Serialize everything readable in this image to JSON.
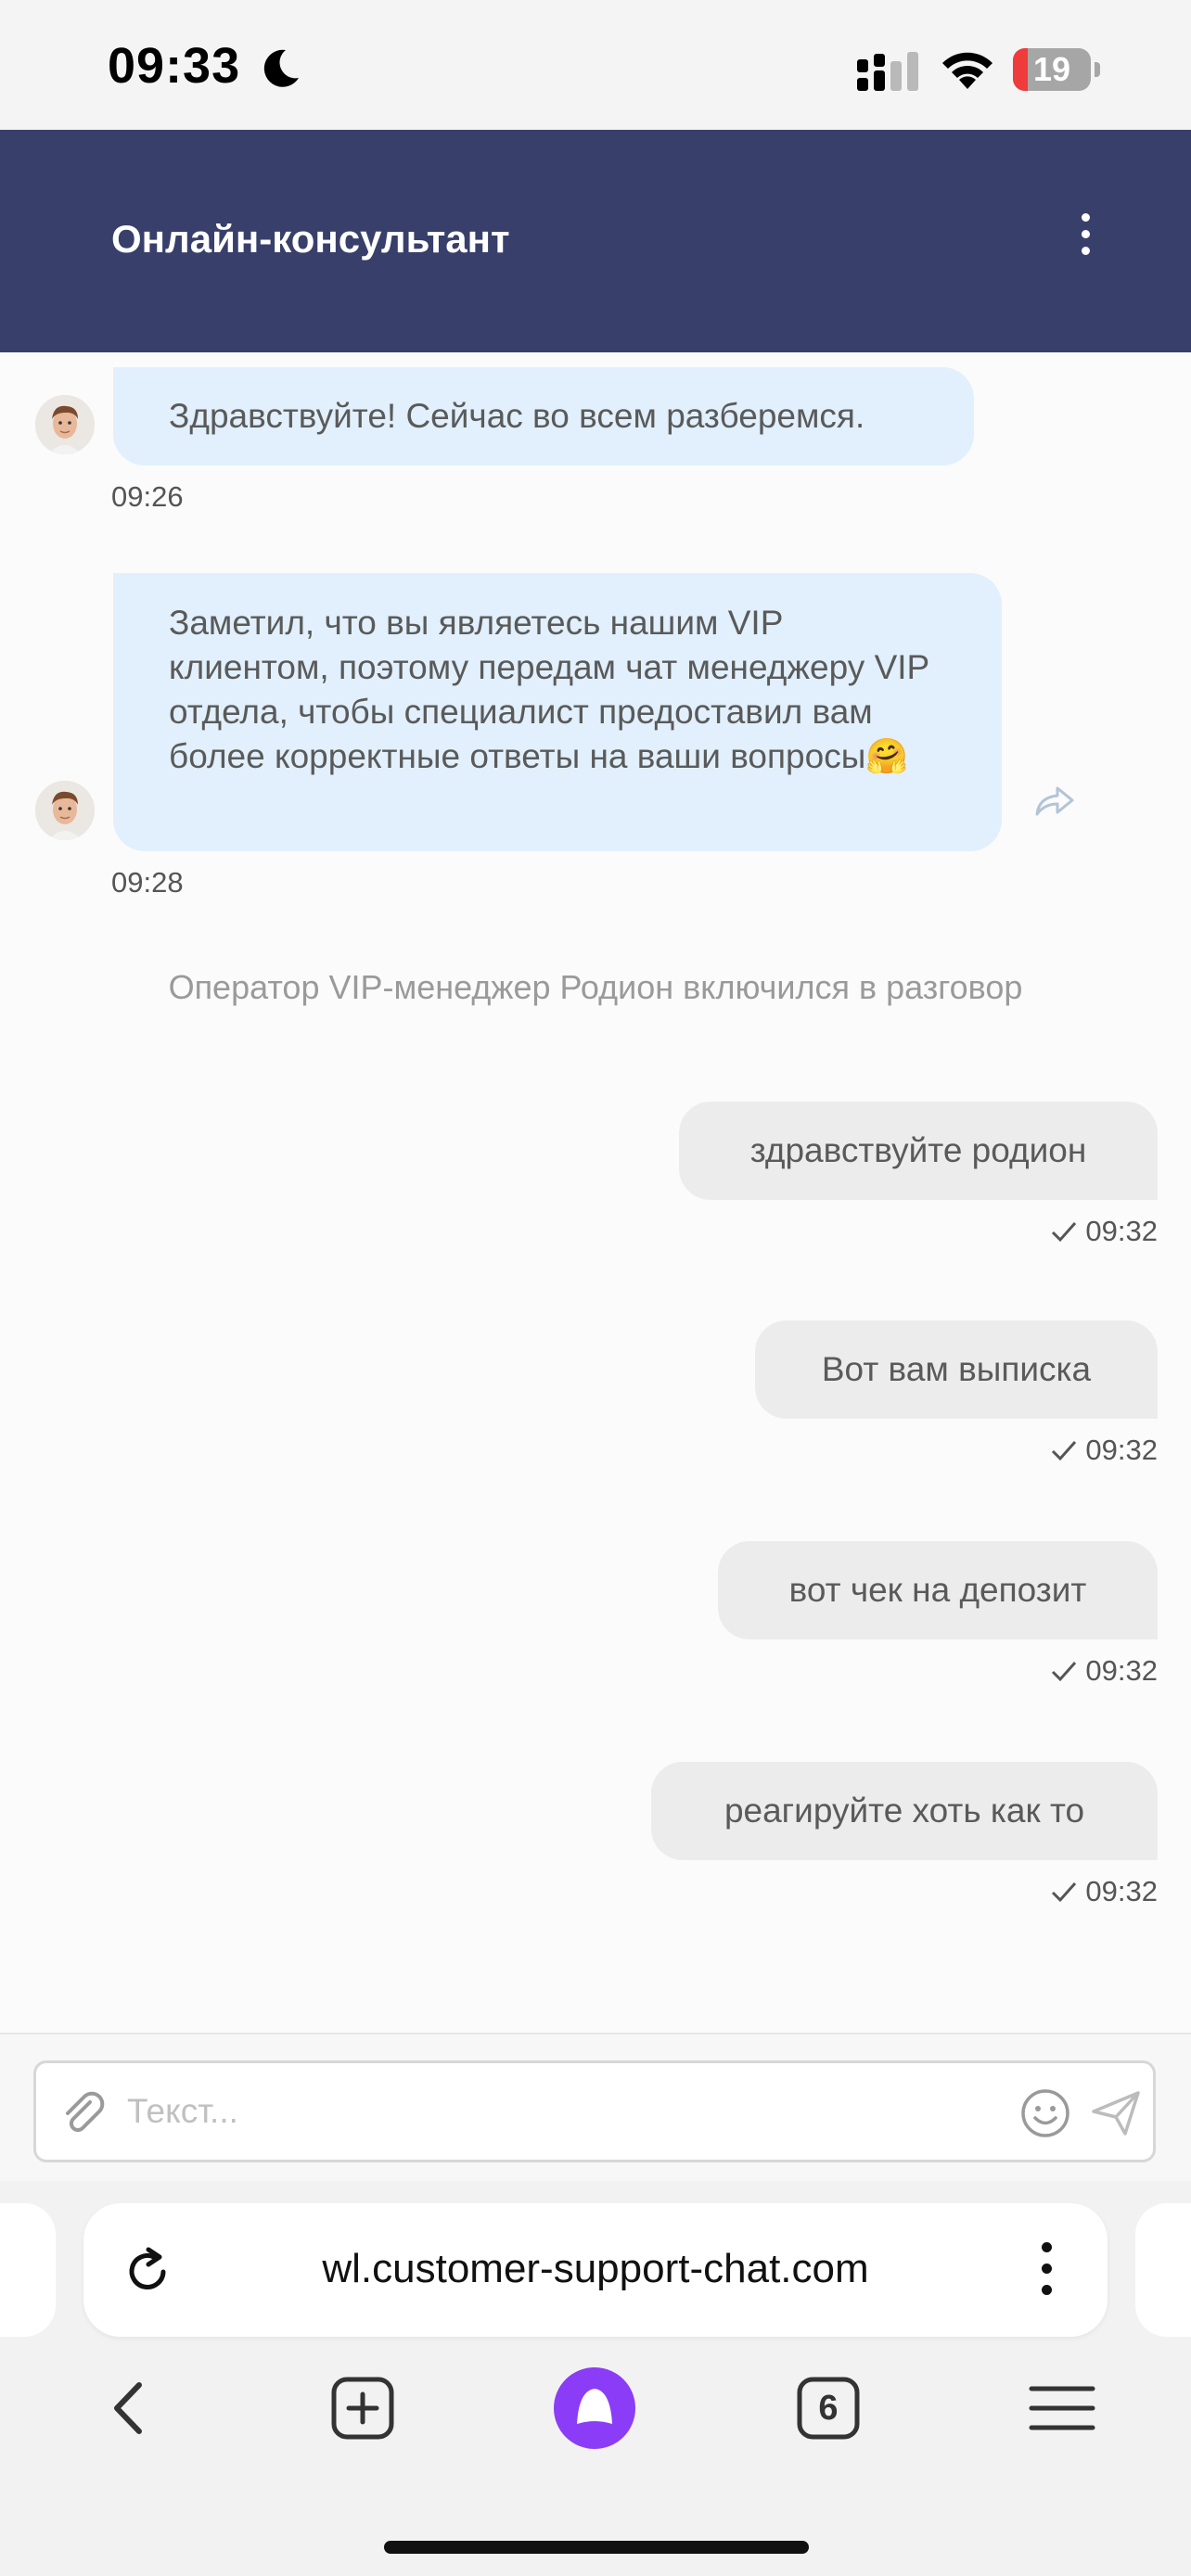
{
  "status_bar": {
    "time": "09:33",
    "battery": "19",
    "battery_level": 0.19
  },
  "header": {
    "title": "Онлайн-консультант"
  },
  "messages": {
    "m1": {
      "text": "Здравствуйте! Сейчас во всем разберемся.",
      "time": "09:26"
    },
    "m2": {
      "text": "Заметил, что вы являетесь нашим VIP клиентом, поэтому передам чат менеджеру VIP отдела, чтобы специалист предоставил вам более корректные ответы на ваши вопросы",
      "emoji": "🤗",
      "time": "09:28"
    },
    "system": "Оператор VIP-менеджер Родион включился в разговор",
    "u1": {
      "text": "здравствуйте родион",
      "time": "09:32"
    },
    "u2": {
      "text": "Вот вам выписка",
      "time": "09:32"
    },
    "u3": {
      "text": "вот чек на депозит",
      "time": "09:32"
    },
    "u4": {
      "text": "реагируйте хоть как то",
      "time": "09:32"
    }
  },
  "input": {
    "placeholder": "Текст..."
  },
  "browser": {
    "url": "wl.customer-support-chat.com",
    "tabs_count": "6"
  },
  "colors": {
    "header_bg": "#383f6b",
    "incoming_bubble": "#e1f0fc",
    "outgoing_bubble": "#ececec",
    "assistant_accent": "#8b3cf6"
  }
}
